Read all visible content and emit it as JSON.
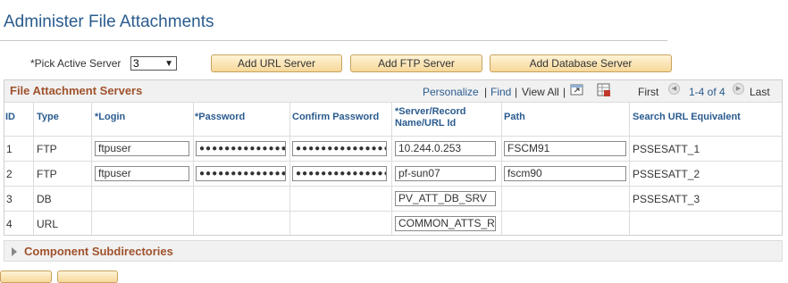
{
  "page": {
    "title": "Administer File Attachments"
  },
  "pick_server": {
    "label": "*Pick Active Server",
    "value": "3"
  },
  "buttons": {
    "add_url": "Add URL Server",
    "add_ftp": "Add FTP Server",
    "add_db": "Add Database Server"
  },
  "grid": {
    "title": "File Attachment Servers",
    "nav": {
      "personalize": "Personalize",
      "find": "Find",
      "view_all": "View All",
      "first": "First",
      "range": "1-4 of 4",
      "last": "Last"
    },
    "columns": {
      "id": "ID",
      "type": "Type",
      "login": "*Login",
      "password": "*Password",
      "confirm": "Confirm Password",
      "server_line1": "*Server/Record",
      "server_line2": "Name/URL Id",
      "path": "Path",
      "search_url": "Search URL Equivalent"
    },
    "rows": [
      {
        "id": "1",
        "type": "FTP",
        "login": "ftpuser",
        "password": "●●●●●●●●●●●●●●●●●",
        "confirm": "●●●●●●●●●●●●●●●●●",
        "server": "10.244.0.253",
        "path": "FSCM91",
        "search_url": "PSSESATT_1"
      },
      {
        "id": "2",
        "type": "FTP",
        "login": "ftpuser",
        "password": "●●●●●●●●●●●●●●●●●",
        "confirm": "●●●●●●●●●●●●●●●●●",
        "server": "pf-sun07",
        "path": "fscm90",
        "search_url": "PSSESATT_2"
      },
      {
        "id": "3",
        "type": "DB",
        "server": "PV_ATT_DB_SRV",
        "search_url": "PSSESATT_3"
      },
      {
        "id": "4",
        "type": "URL",
        "server": "COMMON_ATTS_RI"
      }
    ]
  },
  "component_subdirectories": {
    "label": "Component Subdirectories"
  }
}
